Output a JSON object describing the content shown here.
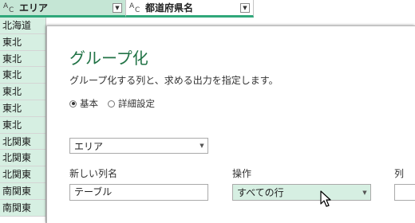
{
  "grid": {
    "columns": [
      {
        "type_icon": "abc-text-type-icon",
        "type_a": "A",
        "type_c": "C",
        "type_b": "B",
        "name": "エリア"
      },
      {
        "type_icon": "abc-text-type-icon",
        "type_a": "A",
        "type_c": "C",
        "type_b": "B",
        "name": "都道府県名"
      }
    ],
    "rows": [
      "北海道",
      "東北",
      "東北",
      "東北",
      "東北",
      "東北",
      "東北",
      "北関東",
      "北関東",
      "北関東",
      "南関東",
      "南関東"
    ],
    "selected_color": "#c5e6d5",
    "accent_color": "#2fa77a"
  },
  "dialog": {
    "title": "グループ化",
    "description": "グループ化する列と、求める出力を指定します。",
    "radios": [
      {
        "label": "基本",
        "checked": true
      },
      {
        "label": "詳細設定",
        "checked": false
      }
    ],
    "group_by_value": "エリア",
    "new_column_label": "新しい列名",
    "operation_label": "操作",
    "column_label": "列",
    "new_column_value": "テーブル",
    "operation_value": "すべての行",
    "title_color": "#217346"
  }
}
